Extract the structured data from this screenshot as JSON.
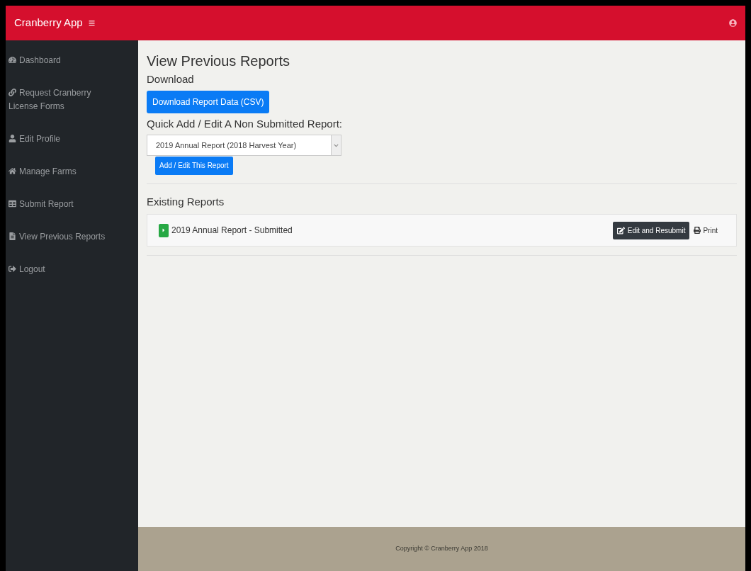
{
  "header": {
    "brand": "Cranberry App",
    "menu_glyph": "≡"
  },
  "sidebar": {
    "items": [
      {
        "label": "Dashboard",
        "selected": false
      },
      {
        "label": "Request Cranberry License Forms",
        "selected": false
      },
      {
        "label": "Edit Profile",
        "selected": false
      },
      {
        "label": "Manage Farms",
        "selected": false
      },
      {
        "label": "Submit Report",
        "selected": false
      },
      {
        "label": "View Previous Reports",
        "selected": false
      },
      {
        "label": "Logout",
        "selected": false
      }
    ]
  },
  "main": {
    "title": "View Previous Reports",
    "download_label": "Download",
    "download_button": "Download Report Data (CSV)",
    "quick_label": "Quick Add / Edit A Non Submitted Report:",
    "report_select": {
      "value": "2019 Annual Report (2018 Harvest Year)"
    },
    "add_button": "Add / Edit This Report",
    "existing_label": "Existing Reports",
    "reports": [
      {
        "title": "2019 Annual Report - Submitted",
        "edit_button": "Edit and Resubmit",
        "print_link": "Print"
      }
    ]
  },
  "footer": {
    "text": "Copyright © Cranberry App 2018"
  }
}
